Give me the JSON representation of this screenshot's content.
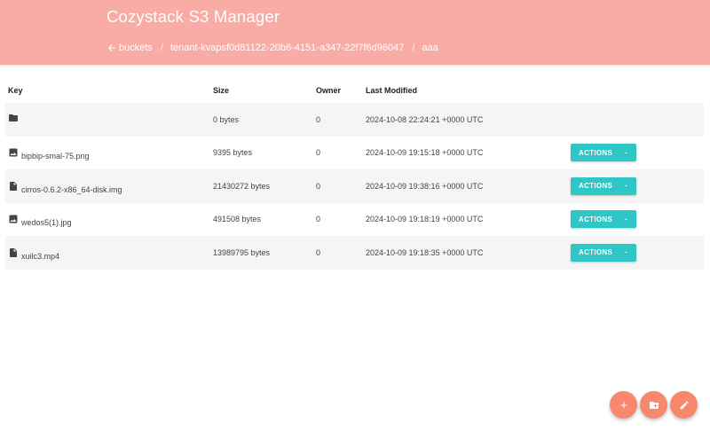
{
  "app": {
    "title": "Cozystack S3 Manager"
  },
  "breadcrumb": {
    "back_label": "buckets",
    "items": [
      "tenant-kvapsf0d81122-20b6-4151-a347-22f7f6d96047",
      "aaa"
    ]
  },
  "table": {
    "headers": {
      "key": "Key",
      "size": "Size",
      "owner": "Owner",
      "last_modified": "Last Modified"
    },
    "rows": [
      {
        "icon": "folder-icon",
        "key": "",
        "size": "0 bytes",
        "owner": "0",
        "last_modified": "2024-10-08 22:24:21 +0000 UTC",
        "has_actions": false
      },
      {
        "icon": "image-icon",
        "key": "bipbip-smal-75.png",
        "size": "9395 bytes",
        "owner": "0",
        "last_modified": "2024-10-09 19:15:18 +0000 UTC",
        "has_actions": true
      },
      {
        "icon": "file-icon",
        "key": "cirros-0.6.2-x86_64-disk.img",
        "size": "21430272 bytes",
        "owner": "0",
        "last_modified": "2024-10-09 19:38:16 +0000 UTC",
        "has_actions": true
      },
      {
        "icon": "image-icon",
        "key": "wedos5(1).jpg",
        "size": "491508 bytes",
        "owner": "0",
        "last_modified": "2024-10-09 19:18:19 +0000 UTC",
        "has_actions": true
      },
      {
        "icon": "file-icon",
        "key": "xuilc3.mp4",
        "size": "13989795 bytes",
        "owner": "0",
        "last_modified": "2024-10-09 19:18:35 +0000 UTC",
        "has_actions": true
      }
    ],
    "actions_label": "ACTIONS"
  },
  "fabs": [
    {
      "icon": "plus-icon"
    },
    {
      "icon": "create-folder-icon"
    },
    {
      "icon": "pencil-icon"
    }
  ],
  "colors": {
    "header": "#f9aca6",
    "accent": "#2ec6c6",
    "fab": "#f7876d"
  }
}
